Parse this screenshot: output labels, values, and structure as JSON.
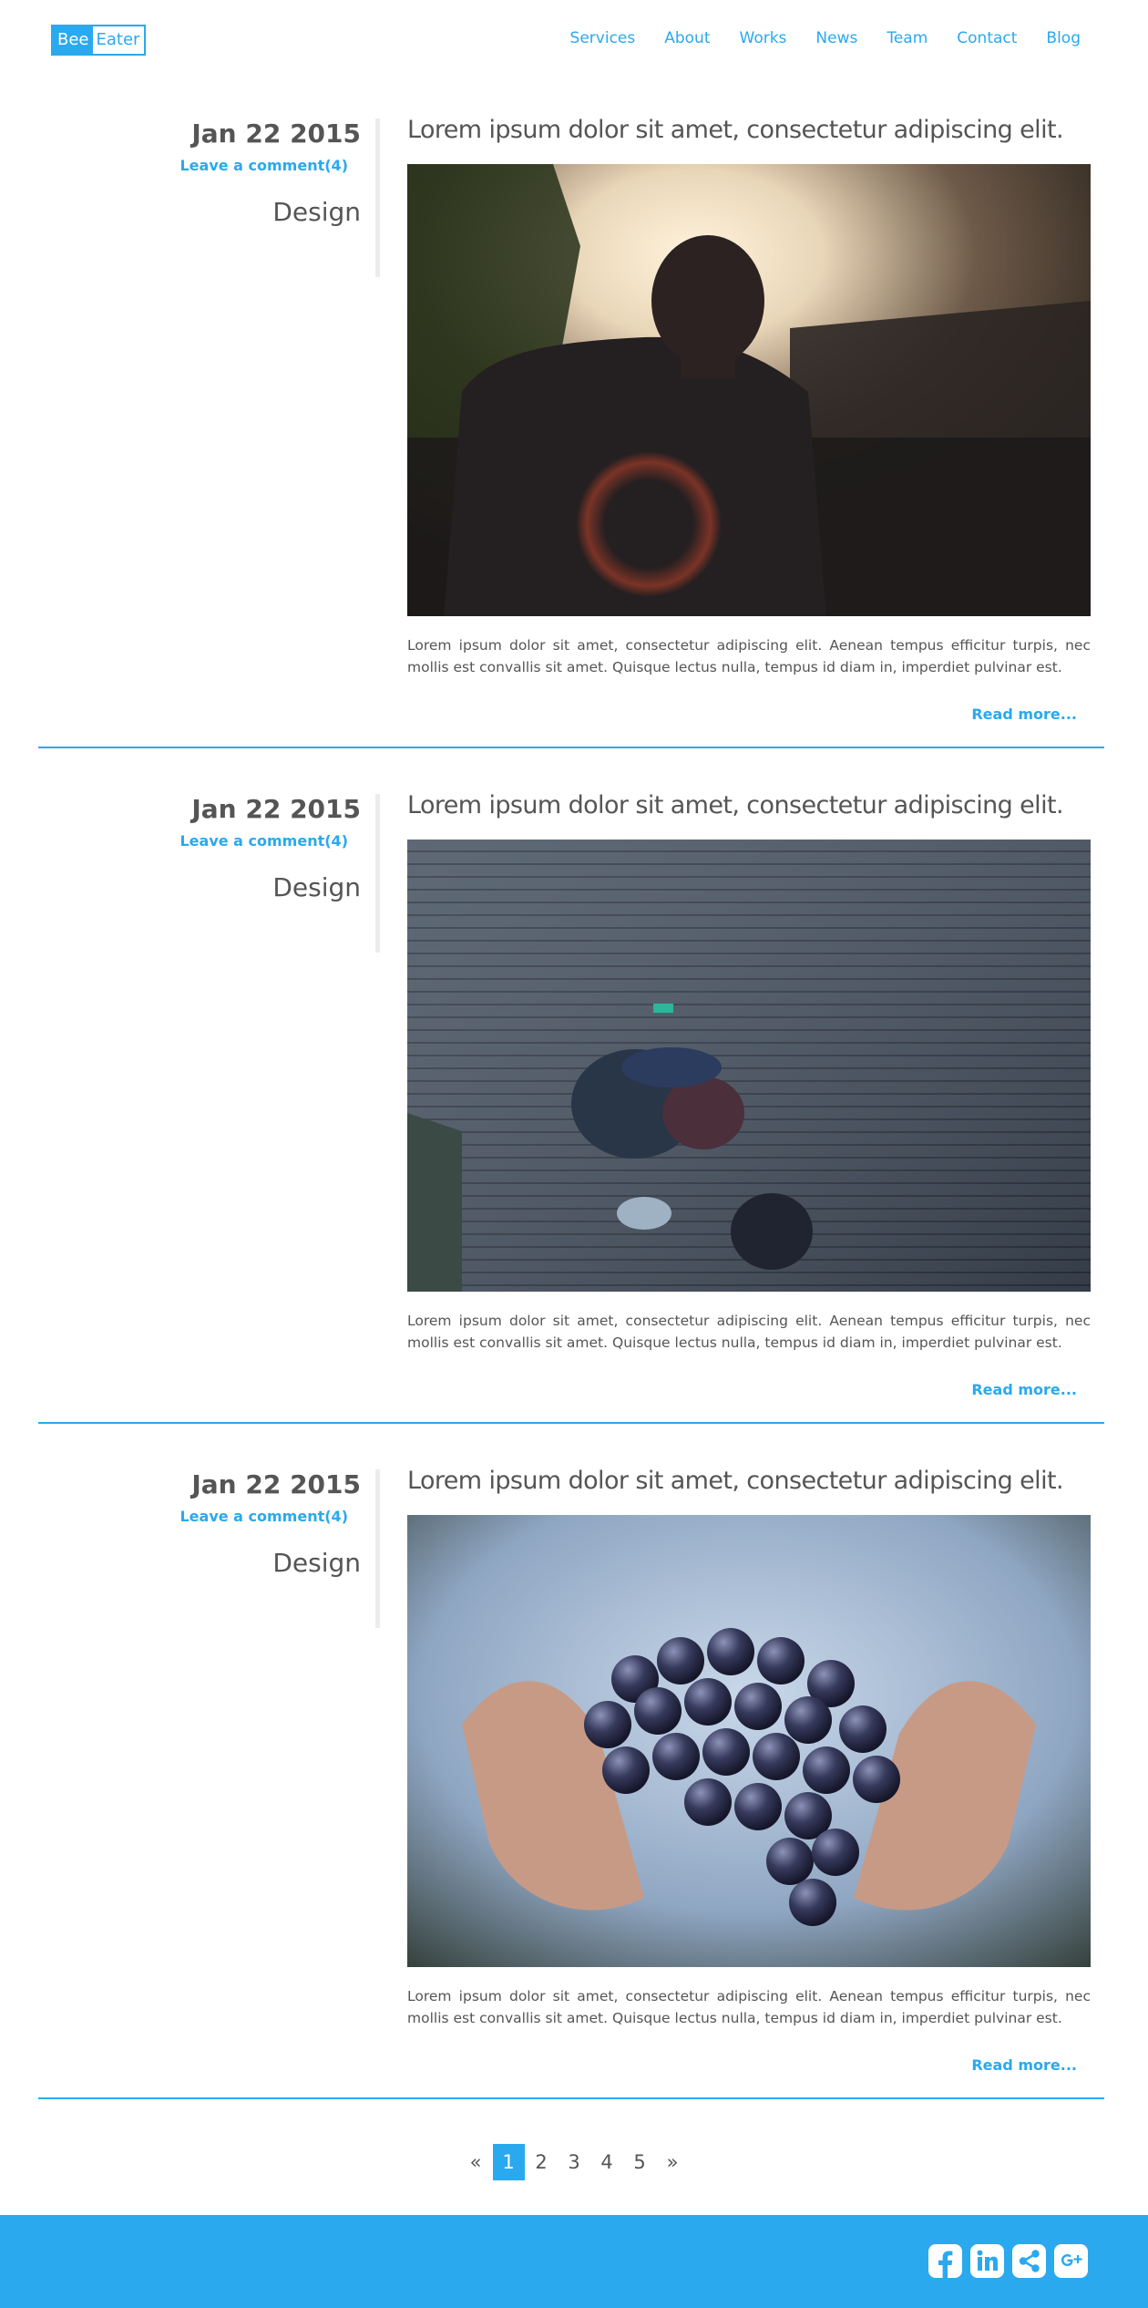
{
  "header": {
    "logo_part1": "Bee",
    "logo_part2": "Eater",
    "nav": [
      "Services",
      "About",
      "Works",
      "News",
      "Team",
      "Contact",
      "Blog"
    ]
  },
  "posts": [
    {
      "date": "Jan 22 2015",
      "comment_link": "Leave a comment(4)",
      "category": "Design",
      "title": "Lorem ipsum dolor sit amet, consectetur adipiscing elit.",
      "excerpt": "Lorem ipsum dolor sit amet, consectetur adipiscing elit. Aenean tempus efficitur turpis, nec mollis est convallis sit amet. Quisque lectus nulla, tempus id diam in, imperdiet pulvinar est.",
      "read_more": "Read more..."
    },
    {
      "date": "Jan 22 2015",
      "comment_link": "Leave a comment(4)",
      "category": "Design",
      "title": "Lorem ipsum dolor sit amet, consectetur adipiscing elit.",
      "excerpt": "Lorem ipsum dolor sit amet, consectetur adipiscing elit. Aenean tempus efficitur turpis, nec mollis est convallis sit amet. Quisque lectus nulla, tempus id diam in, imperdiet pulvinar est.",
      "read_more": "Read more..."
    },
    {
      "date": "Jan 22 2015",
      "comment_link": "Leave a comment(4)",
      "category": "Design",
      "title": "Lorem ipsum dolor sit amet, consectetur adipiscing elit.",
      "excerpt": "Lorem ipsum dolor sit amet, consectetur adipiscing elit. Aenean tempus efficitur turpis, nec mollis est convallis sit amet. Quisque lectus nulla, tempus id diam in, imperdiet pulvinar est.",
      "read_more": "Read more..."
    }
  ],
  "pagination": {
    "prev": "«",
    "pages": [
      "1",
      "2",
      "3",
      "4",
      "5"
    ],
    "current": "1",
    "next": "»"
  },
  "footer": {
    "social_icons": [
      "facebook-icon",
      "linkedin-icon",
      "share-icon",
      "google-plus-icon"
    ]
  },
  "colors": {
    "accent": "#2aa9ee",
    "text": "#555555"
  }
}
